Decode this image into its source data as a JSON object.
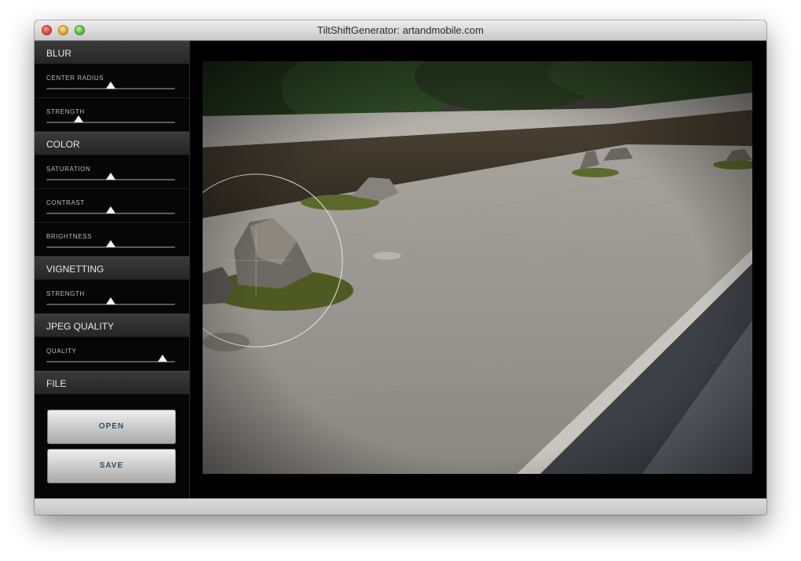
{
  "window": {
    "title": "TiltShiftGenerator: artandmobile.com"
  },
  "sections": {
    "blur": {
      "header": "BLUR",
      "center_radius": {
        "label": "CENTER RADIUS",
        "value": 0.5
      },
      "strength": {
        "label": "STRENGTH",
        "value": 0.25
      }
    },
    "color": {
      "header": "COLOR",
      "saturation": {
        "label": "SATURATION",
        "value": 0.5
      },
      "contrast": {
        "label": "CONTRAST",
        "value": 0.5
      },
      "brightness": {
        "label": "BRIGHTNESS",
        "value": 0.5
      }
    },
    "vignetting": {
      "header": "VIGNETTING",
      "strength": {
        "label": "STRENGTH",
        "value": 0.5
      }
    },
    "jpeg": {
      "header": "JPEG QUALITY",
      "quality": {
        "label": "QUALITY",
        "value": 0.9
      }
    },
    "file": {
      "header": "FILE",
      "open_label": "OPEN",
      "save_label": "SAVE"
    }
  },
  "colors": {
    "panel": "#060606",
    "header": "#2f2f2f",
    "button_text": "#2f4d63"
  }
}
